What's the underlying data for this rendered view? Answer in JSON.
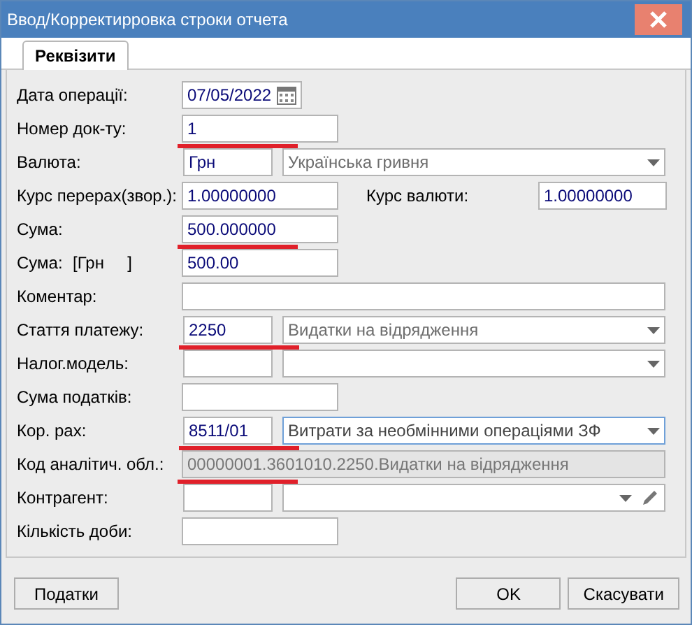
{
  "window": {
    "title": "Ввод/Корректирровка строки отчета"
  },
  "tabs": [
    {
      "label": "Реквізити",
      "selected": true
    }
  ],
  "rows": [
    {
      "kind": "date",
      "label": "Дата операції:",
      "value": "07/05/2022",
      "annotated": false
    },
    {
      "kind": "short",
      "label": "Номер док-ту:",
      "value": "1",
      "annotated": true
    },
    {
      "kind": "combo",
      "label": "Валюта:",
      "code": "Грн",
      "name": "Українська гривня",
      "annotated": false,
      "focused": false,
      "edit_button": false
    },
    {
      "kind": "rate",
      "label": "Курс перерах(звор.):",
      "value": "1.00000000",
      "label_2": "Курс валюти:",
      "value_2": "1.00000000"
    },
    {
      "kind": "short",
      "label": "Сума:",
      "value": "500.000000",
      "annotated": true
    },
    {
      "kind": "currency",
      "label": "Сума:",
      "tag": "[Грн     ]",
      "value": "500.00"
    },
    {
      "kind": "wide",
      "label": "Коментар:",
      "value": "",
      "disabled": false,
      "annotated": false
    },
    {
      "kind": "combo",
      "label": "Стаття платежу:",
      "code": "2250",
      "name": "Видатки на відрядження",
      "annotated": true,
      "focused": false,
      "edit_button": false
    },
    {
      "kind": "combo",
      "label": "Налог.модель:",
      "code": "",
      "name": "",
      "annotated": false,
      "focused": false,
      "edit_button": false
    },
    {
      "kind": "short",
      "label": "Сума податків:",
      "value": "",
      "annotated": false
    },
    {
      "kind": "combo",
      "label": "Кор. рах:",
      "code": "8511/01",
      "name": "Витрати за необмінними операціями ЗФ",
      "annotated": true,
      "focused": true,
      "edit_button": false
    },
    {
      "kind": "wide",
      "label": "Код аналітич. обл.:",
      "value": "00000001.3601010.2250.Видатки на відрядження",
      "disabled": true,
      "annotated": true
    },
    {
      "kind": "combo",
      "label": "Контрагент:",
      "code": "",
      "name": "",
      "annotated": false,
      "focused": false,
      "edit_button": true
    },
    {
      "kind": "short",
      "label": "Кількість доби:",
      "value": "",
      "annotated": false
    }
  ],
  "buttons": {
    "left": "Податки",
    "ok": "OK",
    "cancel": "Скасувати"
  }
}
